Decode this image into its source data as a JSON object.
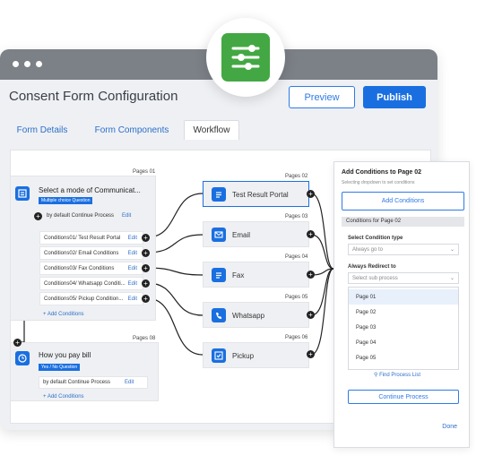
{
  "header": {
    "title": "Consent Form Configuration",
    "preview_label": "Preview",
    "publish_label": "Publish"
  },
  "tabs": [
    "Form Details",
    "Form Components",
    "Workflow"
  ],
  "source_nodes": {
    "node1": {
      "page": "Pages 01",
      "title": "Select a mode of Communicat...",
      "badge": "Multiple choice Question",
      "default_text": "by default Continue Process",
      "edit": "Edit",
      "conditions": [
        "Conditions01/ Test Result Portal",
        "Conditions02/ Email Conditions",
        "Conditions03/ Fax Conditions",
        "Conditions04/ Whatsapp Conditi...",
        "Conditions05/ Pickup Condition..."
      ],
      "add_conditions": "+ Add Conditions"
    },
    "node2": {
      "page": "Pages 08",
      "title": "How you pay bill",
      "badge": "Yes / No Question",
      "default_text": "by default Continue Process",
      "edit": "Edit",
      "add_conditions": "+ Add Conditions"
    }
  },
  "destinations": [
    {
      "page": "Pages 02",
      "label": "Test Result Portal",
      "icon": "document-icon"
    },
    {
      "page": "Pages 03",
      "label": "Email",
      "icon": "mail-icon"
    },
    {
      "page": "Pages 04",
      "label": "Fax",
      "icon": "document-icon"
    },
    {
      "page": "Pages 05",
      "label": "Whatsapp",
      "icon": "phone-icon"
    },
    {
      "page": "Pages 06",
      "label": "Pickup",
      "icon": "checkbox-icon"
    }
  ],
  "panel": {
    "title": "Add Conditions to Page 02",
    "subtitle": "Selecting dropdown to set conditions",
    "add_conditions_label": "Add Conditions",
    "section_header": "Conditions for Page 02",
    "condition_type_label": "Select Condition type",
    "condition_type_value": "Always go to",
    "redirect_label": "Always Redirect to",
    "redirect_placeholder": "Select sub process",
    "options": [
      "Page 01",
      "Page 02",
      "Page 03",
      "Page 04",
      "Page 05"
    ],
    "find_label": "Find Process List",
    "continue_label": "Continue Process",
    "done_label": "Done"
  },
  "colors": {
    "accent": "#1a6fe0",
    "logo": "#43a843",
    "titlebar": "#7c8187"
  }
}
